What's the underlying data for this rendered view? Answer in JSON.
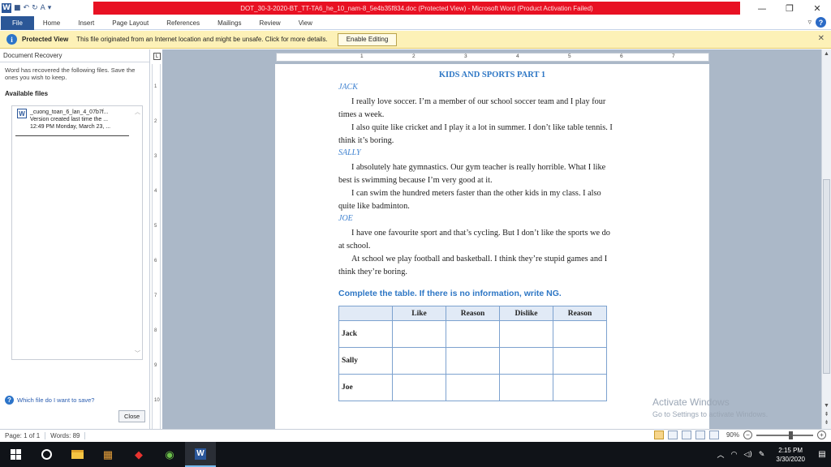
{
  "window": {
    "title": "DOT_30-3-2020-BT_TT-TA6_he_10_nam-8_5e4b35f834.doc (Protected View) - Microsoft Word (Product Activation Failed)",
    "quick_access": [
      "W",
      "save",
      "undo",
      "redo",
      "A",
      "customize"
    ],
    "controls": [
      "minimize",
      "maximize",
      "close"
    ]
  },
  "ribbon": {
    "tabs": [
      "File",
      "Home",
      "Insert",
      "Page Layout",
      "References",
      "Mailings",
      "Review",
      "View"
    ]
  },
  "protected_view": {
    "title": "Protected View",
    "message": "This file originated from an Internet location and might be unsafe. Click for more details.",
    "button": "Enable Editing"
  },
  "recovery": {
    "header": "Document Recovery",
    "intro": "Word has recovered the following files.  Save the ones you wish to keep.",
    "available_label": "Available files",
    "item": {
      "name": "_cuong_toan_6_lan_4_07b7f...",
      "line2": "Version created last time the ...",
      "line3": "12:49 PM Monday, March 23, ..."
    },
    "which_file": "Which file do I want to save?",
    "close_button": "Close"
  },
  "ruler": {
    "h_labels": [
      "1",
      "2",
      "3",
      "4",
      "5",
      "6",
      "7"
    ],
    "v_labels": [
      "1",
      "2",
      "3",
      "4",
      "5",
      "6",
      "7",
      "8",
      "9",
      "10"
    ]
  },
  "document": {
    "title": "KIDS AND SPORTS PART 1",
    "sections": [
      {
        "name": "JACK",
        "paragraphs": [
          "I really love soccer. I’m a member of our school soccer team and I play four times a week.",
          "I also quite like cricket and I play it a lot in summer. I don’t like table tennis. I think it’s boring."
        ]
      },
      {
        "name": "SALLY",
        "paragraphs": [
          "I absolutely hate gymnastics. Our gym teacher is really horrible. What I like best is swimming because I’m very good at it.",
          "I can swim the hundred meters faster than the other kids in my class. I also quite like badminton."
        ]
      },
      {
        "name": "JOE",
        "paragraphs": [
          "I have one favourite sport and that’s cycling. But I don’t like the sports we do at school.",
          "At school we play football and basketball. I think they’re stupid games and I think they’re boring."
        ]
      }
    ],
    "task": "Complete the table. If there is no information, write NG.",
    "table": {
      "headers": [
        "",
        "Like",
        "Reason",
        "Dislike",
        "Reason"
      ],
      "rows": [
        "Jack",
        "Sally",
        "Joe"
      ]
    }
  },
  "watermark": {
    "line1": "Activate Windows",
    "line2": "Go to Settings to activate Windows."
  },
  "statusbar": {
    "page": "Page: 1 of 1",
    "words": "Words: 89",
    "zoom": "90%"
  },
  "taskbar": {
    "time": "2:15 PM",
    "date": "3/30/2020"
  }
}
